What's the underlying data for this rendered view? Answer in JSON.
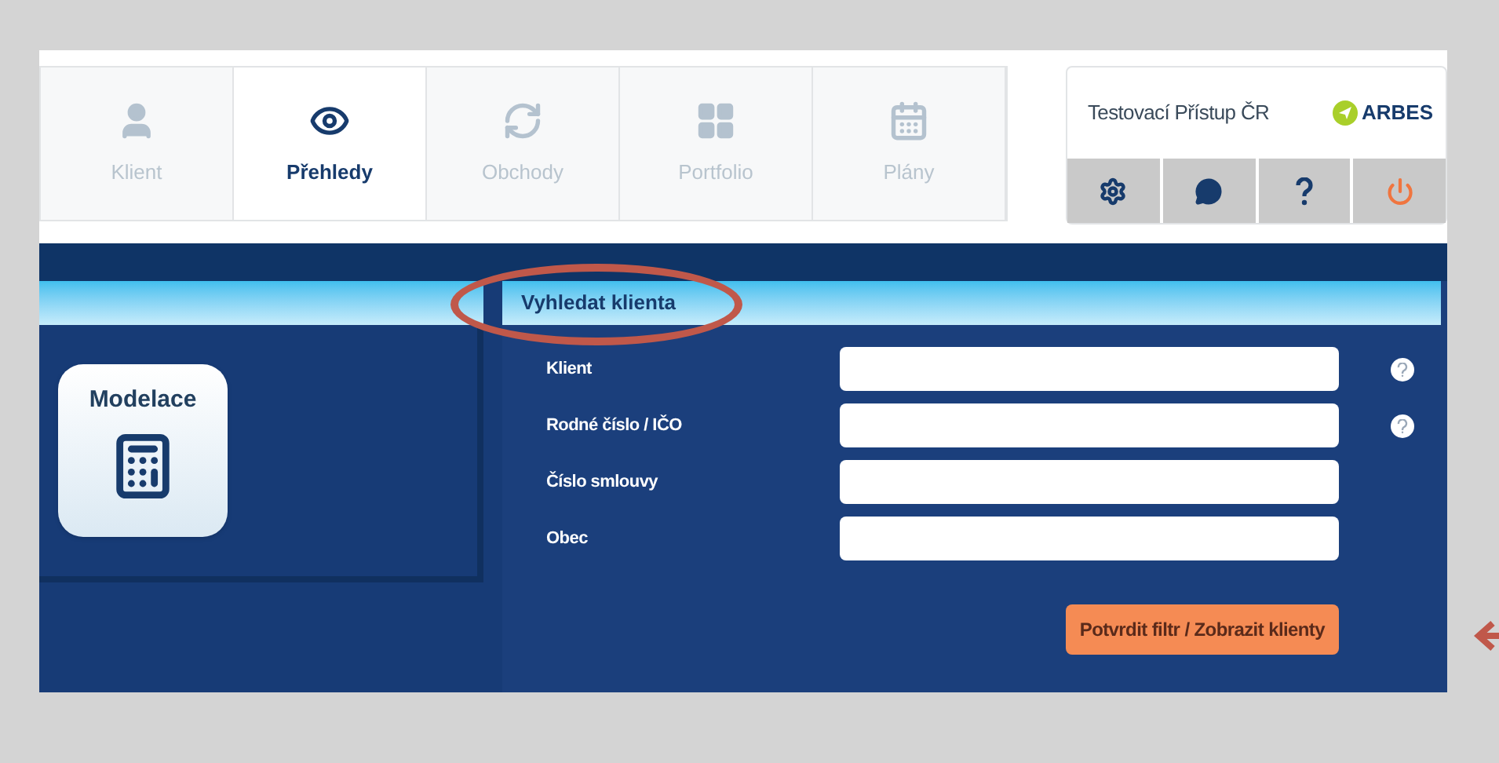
{
  "nav_tabs": [
    {
      "label": "Klient",
      "kind": "user",
      "selected": false
    },
    {
      "label": "Přehledy",
      "kind": "eye",
      "selected": true
    },
    {
      "label": "Obchody",
      "kind": "refresh",
      "selected": false
    },
    {
      "label": "Portfolio",
      "kind": "grid",
      "selected": false
    },
    {
      "label": "Plány",
      "kind": "calendar",
      "selected": false
    }
  ],
  "user_panel": {
    "name": "Testovací Přístup ČR",
    "logo": "ARBES",
    "buttons": [
      {
        "kind": "settings"
      },
      {
        "kind": "chat"
      },
      {
        "kind": "help"
      },
      {
        "kind": "power"
      }
    ]
  },
  "tile": {
    "label": "Modelace"
  },
  "search": {
    "title": "Vyhledat klienta",
    "fields": [
      {
        "label": "Klient",
        "help": true
      },
      {
        "label": "Rodné číslo / IČO",
        "help": true
      },
      {
        "label": "Číslo smlouvy",
        "help": false
      },
      {
        "label": "Obec",
        "help": false
      }
    ],
    "submit": "Potvrdit filtr / Zobrazit klienty"
  }
}
